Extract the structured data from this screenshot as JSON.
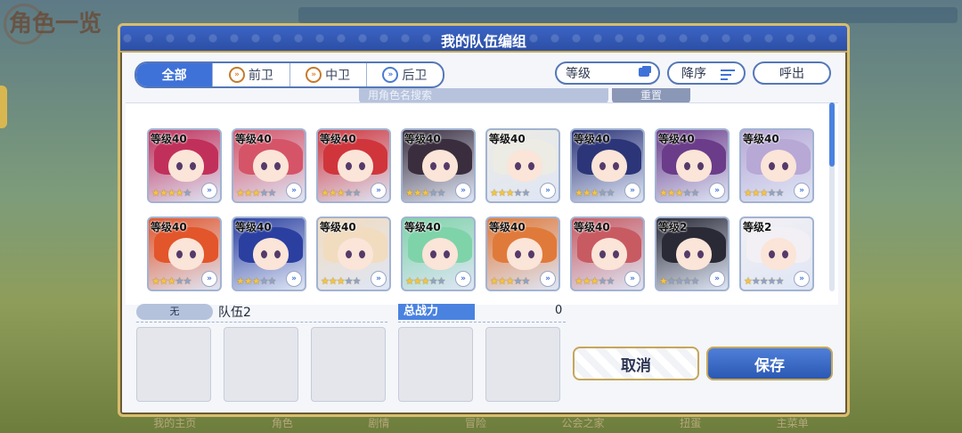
{
  "background": {
    "title": "角色一览",
    "bottom_nav": [
      "我的主页",
      "角色",
      "剧情",
      "冒险",
      "公会之家",
      "扭蛋",
      "主菜单"
    ]
  },
  "dialog": {
    "title": "我的队伍编组",
    "filters": [
      {
        "label": "全部",
        "icon": "none"
      },
      {
        "label": "前卫",
        "icon": "vanguard-icon"
      },
      {
        "label": "中卫",
        "icon": "midguard-icon"
      },
      {
        "label": "后卫",
        "icon": "rearguard-icon"
      }
    ],
    "level_sort_label": "等级",
    "order_label": "降序",
    "call_label": "呼出",
    "search_placeholder": "用角色名搜索",
    "reset_label": "重置",
    "characters": [
      {
        "level": "等级40",
        "stars": 4,
        "hair": "#c1305a"
      },
      {
        "level": "等级40",
        "stars": 3,
        "hair": "#d55468"
      },
      {
        "level": "等级40",
        "stars": 3,
        "hair": "#d0353c"
      },
      {
        "level": "等级40",
        "stars": 3,
        "hair": "#3a2e3e"
      },
      {
        "level": "等级40",
        "stars": 3,
        "hair": "#ecebe4"
      },
      {
        "level": "等级40",
        "stars": 3,
        "hair": "#2c3578"
      },
      {
        "level": "等级40",
        "stars": 3,
        "hair": "#6b3c8a"
      },
      {
        "level": "等级40",
        "stars": 3,
        "hair": "#b7a8d6"
      },
      {
        "level": "等级40",
        "stars": 3,
        "hair": "#e3552a"
      },
      {
        "level": "等级40",
        "stars": 3,
        "hair": "#2b3fa0"
      },
      {
        "level": "等级40",
        "stars": 3,
        "hair": "#f1dcc0"
      },
      {
        "level": "等级40",
        "stars": 3,
        "hair": "#7fd3a9"
      },
      {
        "level": "等级40",
        "stars": 3,
        "hair": "#e07a3a"
      },
      {
        "level": "等级40",
        "stars": 3,
        "hair": "#c85a62"
      },
      {
        "level": "等级2",
        "stars": 1,
        "hair": "#2a2a36"
      },
      {
        "level": "等级2",
        "stars": 1,
        "hair": "#f2f0f4"
      }
    ],
    "team_badge": "无",
    "team_name": "队伍2",
    "power_label": "总战力",
    "power_value": "0",
    "cancel_label": "取消",
    "save_label": "保存"
  }
}
